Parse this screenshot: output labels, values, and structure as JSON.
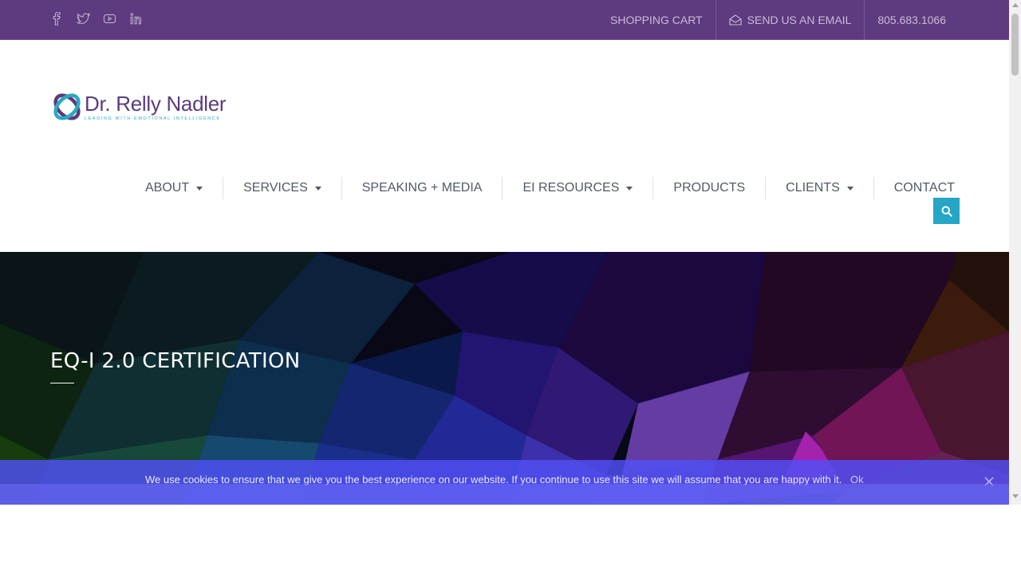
{
  "colors": {
    "topbar_bg": "#5e3a7e",
    "accent": "#25a6c7",
    "brand_purple": "#5b3a7e",
    "nav_text": "#505a66",
    "cookie_bg": "#5050f5"
  },
  "topbar": {
    "social": [
      {
        "icon": "facebook-icon"
      },
      {
        "icon": "twitter-icon"
      },
      {
        "icon": "youtube-icon"
      },
      {
        "icon": "linkedin-icon"
      }
    ],
    "shopping_cart": "SHOPPING CART",
    "email": "SEND US AN EMAIL",
    "phone": "805.683.1066"
  },
  "logo": {
    "name": "Dr. Relly Nadler",
    "tagline": "LEADING WITH EMOTIONAL INTELLIGENCE"
  },
  "nav": {
    "items": [
      {
        "label": "ABOUT",
        "has_dropdown": true
      },
      {
        "label": "SERVICES",
        "has_dropdown": true
      },
      {
        "label": "SPEAKING + MEDIA",
        "has_dropdown": false
      },
      {
        "label": "EI RESOURCES",
        "has_dropdown": true
      },
      {
        "label": "PRODUCTS",
        "has_dropdown": false
      },
      {
        "label": "CLIENTS",
        "has_dropdown": true
      },
      {
        "label": "CONTACT",
        "has_dropdown": false
      }
    ],
    "search_icon": "search-icon"
  },
  "hero": {
    "title": "EQ-I 2.0 CERTIFICATION"
  },
  "cookie": {
    "text": "We use cookies to ensure that we give you the best experience on our website. If you continue to use this site we will assume that you are happy with it.",
    "ok": "Ok",
    "close_icon": "close-icon"
  }
}
